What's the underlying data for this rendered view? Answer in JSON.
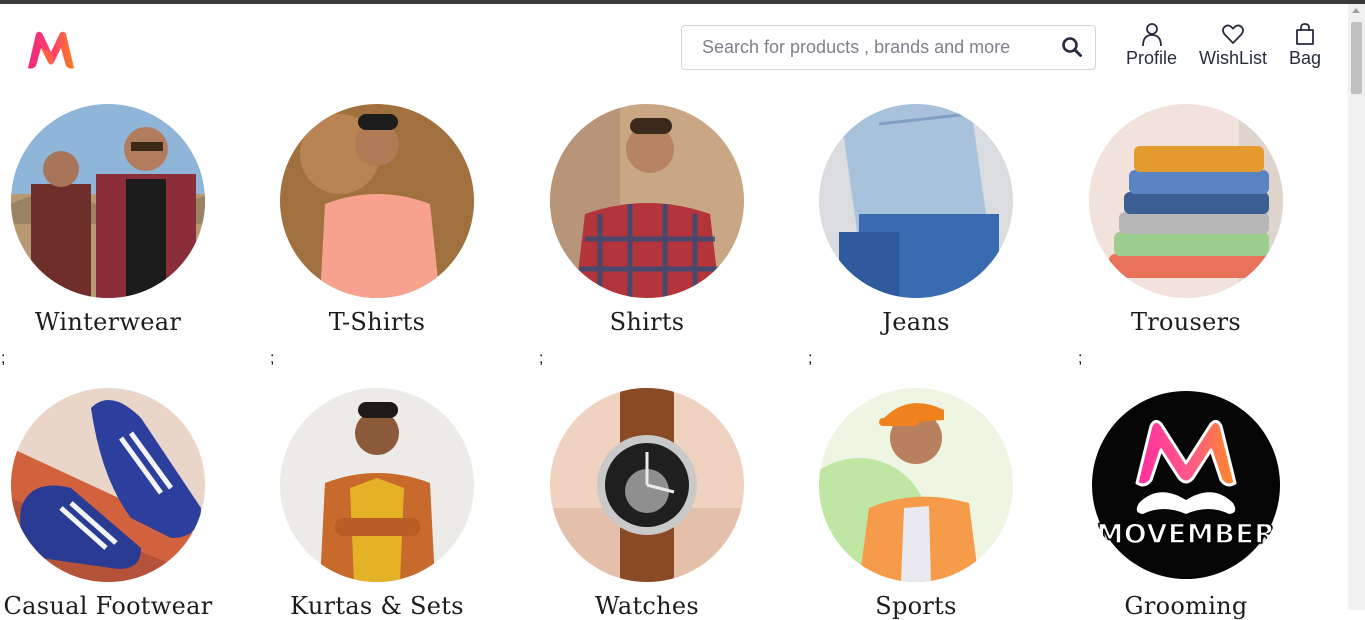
{
  "header": {
    "logo_label": "Myntra",
    "search": {
      "placeholder": "Search for products , brands and more",
      "value": ""
    },
    "nav": [
      {
        "label": "Profile",
        "icon": "user-icon"
      },
      {
        "label": "WishList",
        "icon": "heart-icon"
      },
      {
        "label": "Bag",
        "icon": "bag-icon"
      }
    ]
  },
  "categories": [
    {
      "label": "Winterwear"
    },
    {
      "label": "T-Shirts"
    },
    {
      "label": "Shirts"
    },
    {
      "label": "Jeans"
    },
    {
      "label": "Trousers"
    },
    {
      "label": "Casual Footwear"
    },
    {
      "label": "Kurtas & Sets"
    },
    {
      "label": "Watches"
    },
    {
      "label": "Sports"
    },
    {
      "label": "Grooming",
      "badge": "MOVEMBER"
    }
  ],
  "separator": ";",
  "colors": {
    "brand_pink": "#ff3f6c",
    "brand_orange": "#f7931e",
    "text": "#282c3f"
  }
}
